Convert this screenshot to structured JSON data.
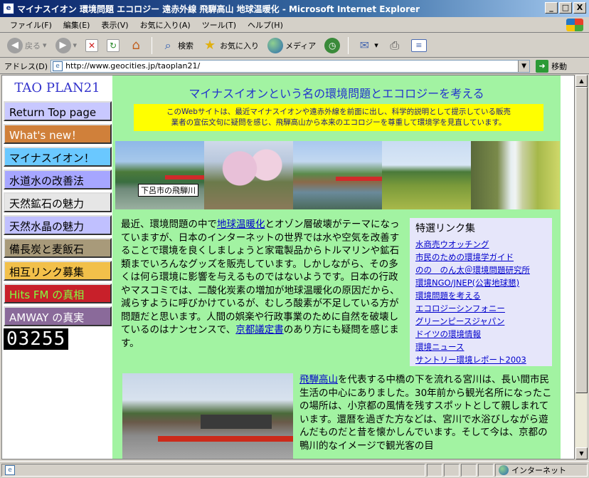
{
  "window": {
    "title": "マイナスイオン 環境問題 エコロジー 遠赤外線 飛騨高山 地球温暖化 - Microsoft Internet Explorer",
    "app_icon": "e",
    "buttons": [
      "_",
      "□",
      "X"
    ]
  },
  "menu": [
    "ファイル(F)",
    "編集(E)",
    "表示(V)",
    "お気に入り(A)",
    "ツール(T)",
    "ヘルプ(H)"
  ],
  "toolbar": {
    "back": "戻る",
    "search": "検索",
    "favorites": "お気に入り",
    "media": "メディア"
  },
  "address": {
    "label": "アドレス(D)",
    "url": "http://www.geocities.jp/taoplan21/",
    "go": "移動"
  },
  "nav": {
    "site_title": "TAO PLAN21",
    "items": [
      {
        "label": "Return Top page",
        "bg": "#c8c8ff",
        "fg": "#000000"
      },
      {
        "label": "What's new！",
        "bg": "#d0803a",
        "fg": "#ffffff"
      },
      {
        "label": "マイナスイオン！",
        "bg": "#6ac8ff",
        "fg": "#000000"
      },
      {
        "label": "水道水の改善法",
        "bg": "#a6a6ff",
        "fg": "#000000"
      },
      {
        "label": "天然鉱石の魅力",
        "bg": "#e6e6e6",
        "fg": "#000000"
      },
      {
        "label": "天然水晶の魅力",
        "bg": "#c0c0ff",
        "fg": "#000000"
      },
      {
        "label": "備長炭と麦飯石",
        "bg": "#a89a7a",
        "fg": "#000000"
      },
      {
        "label": "相互リンク募集",
        "bg": "#f2c04a",
        "fg": "#000000"
      },
      {
        "label": "Hits FM の真相",
        "bg": "#c8202a",
        "fg": "#80ff40"
      },
      {
        "label": "AMWAY の真実",
        "bg": "#8a6a9a",
        "fg": "#ffffff"
      }
    ],
    "counter": "03255"
  },
  "main": {
    "heading": "マイナスイオンという名の環境問題とエコロジーを考える",
    "intro_lines": [
      "このWebサイトは、最近マイナスイオンや遠赤外線を前面に出し、科学的説明として提示している販売",
      "業者の宣伝文句に疑問を感じ、飛騨高山から本来のエコロジーを尊重して環境学を見直しています。"
    ],
    "photo_caption": "下呂市の飛騨川",
    "para1": {
      "t1": "最近、環境問題の中で",
      "link1": "地球温暖化",
      "t2": "とオゾン層破壊がテーマになっていますが、日本のインターネットの世界では水や空気を改善することで環境を良くしましょうと家電製品からトルマリンや鉱石類までいろんなグッズを販売しています。しかしながら、その多くは何ら環境に影響を与えるものではないようです。日本の行政やマスコミでは、二酸化炭素の増加が地球温暖化の原因だから、減らすように呼びかけているが、むしろ酸素が不足している方が問題だと思います。人間の娯楽や行政事業のために自然を破壊しているのはナンセンスで、",
      "link2": "京都議定書",
      "t3": "のあり方にも疑問を感じます。"
    },
    "links_box": {
      "title": "特選リンク集",
      "links": [
        "水商売ウオッチング",
        "市民のための環境学ガイド",
        "のの　のん太＠環境問題研究所",
        "環境NGO/JNEP(公害地球懇)",
        "環境問題を考える",
        "エコロジーシンフォニー",
        "グリーンピースジャパン",
        "ドイツの環境情報",
        "環境ニュース",
        "サントリー環境レポート2003"
      ]
    },
    "para2": {
      "link": "飛騨高山",
      "text": "を代表する中橋の下を流れる宮川は、長い間市民生活の中心にありました。30年前から観光名所になったこの場所は、小京都の風情を残すスポットとして親しまれています。還暦を過ぎた方などは、宮川で水浴びしながら遊んだものだと昔を懐かしんでいます。そして今は、京都の鴨川的なイメージで観光客の目"
    }
  },
  "status": {
    "zone": "インターネット"
  }
}
